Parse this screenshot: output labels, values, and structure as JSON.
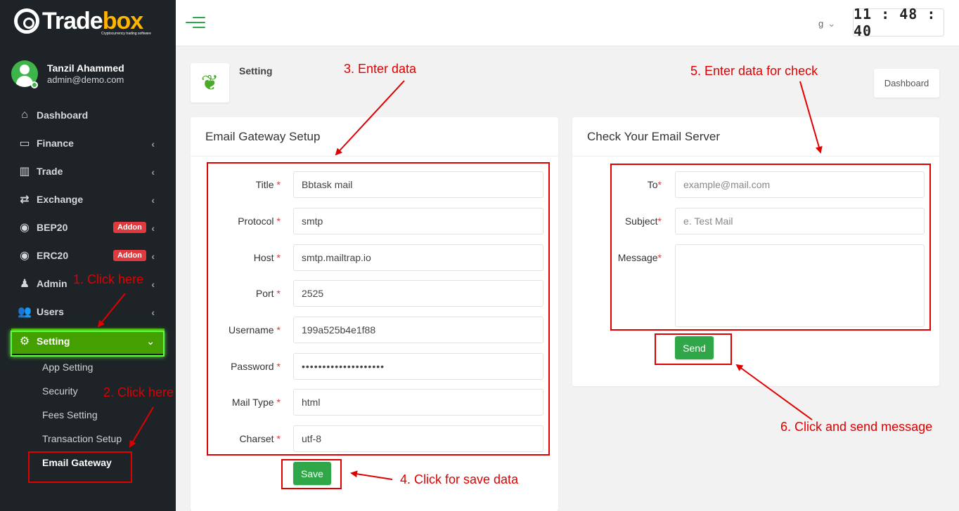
{
  "brand": {
    "name_part1": "Trade",
    "name_part2": "box",
    "tagline": "Cryptocurrency trading software"
  },
  "user": {
    "name": "Tanzil Ahammed",
    "email": "admin@demo.com"
  },
  "sidebar": {
    "items": [
      {
        "label": "Dashboard",
        "icon": "home-icon"
      },
      {
        "label": "Finance",
        "icon": "credit-card-icon"
      },
      {
        "label": "Trade",
        "icon": "chart-icon"
      },
      {
        "label": "Exchange",
        "icon": "exchange-icon"
      },
      {
        "label": "BEP20",
        "icon": "coins-icon",
        "badge": "Addon"
      },
      {
        "label": "ERC20",
        "icon": "coins-icon",
        "badge": "Addon"
      },
      {
        "label": "Admin",
        "icon": "user-tie-icon"
      },
      {
        "label": "Users",
        "icon": "users-icon"
      },
      {
        "label": "Setting",
        "icon": "gear-icon"
      }
    ],
    "sub_items": [
      "App Setting",
      "Security",
      "Fees Setting",
      "Transaction Setup",
      "Email Gateway"
    ]
  },
  "topbar": {
    "lang": "g",
    "clock": "11 : 48 : 40"
  },
  "page": {
    "title": "Setting",
    "dashboard_btn": "Dashboard"
  },
  "email_gateway": {
    "title": "Email Gateway Setup",
    "fields": [
      {
        "label": "Title",
        "value": "Bbtask mail"
      },
      {
        "label": "Protocol",
        "value": "smtp"
      },
      {
        "label": "Host",
        "value": "smtp.mailtrap.io"
      },
      {
        "label": "Port",
        "value": "2525"
      },
      {
        "label": "Username",
        "value": "199a525b4e1f88"
      },
      {
        "label": "Password",
        "value": "••••••••••••••••••••"
      },
      {
        "label": "Mail Type",
        "value": "html"
      },
      {
        "label": "Charset",
        "value": "utf-8"
      }
    ],
    "save_label": "Save"
  },
  "check_email": {
    "title": "Check Your Email Server",
    "to_label": "To",
    "to_placeholder": "example@mail.com",
    "subject_label": "Subject",
    "subject_placeholder": "e. Test Mail",
    "message_label": "Message",
    "send_label": "Send"
  },
  "annotations": {
    "a1": "1. Click here",
    "a2": "2. Click here",
    "a3": "3. Enter data",
    "a4": "4. Click for save data",
    "a5": "5. Enter data for check",
    "a6": "6. Click and send message",
    "color": "#e00000"
  },
  "colors": {
    "sidebar_bg": "#1d2326",
    "active": "#43a000",
    "button": "#2fa748",
    "badge": "#e0393e"
  }
}
